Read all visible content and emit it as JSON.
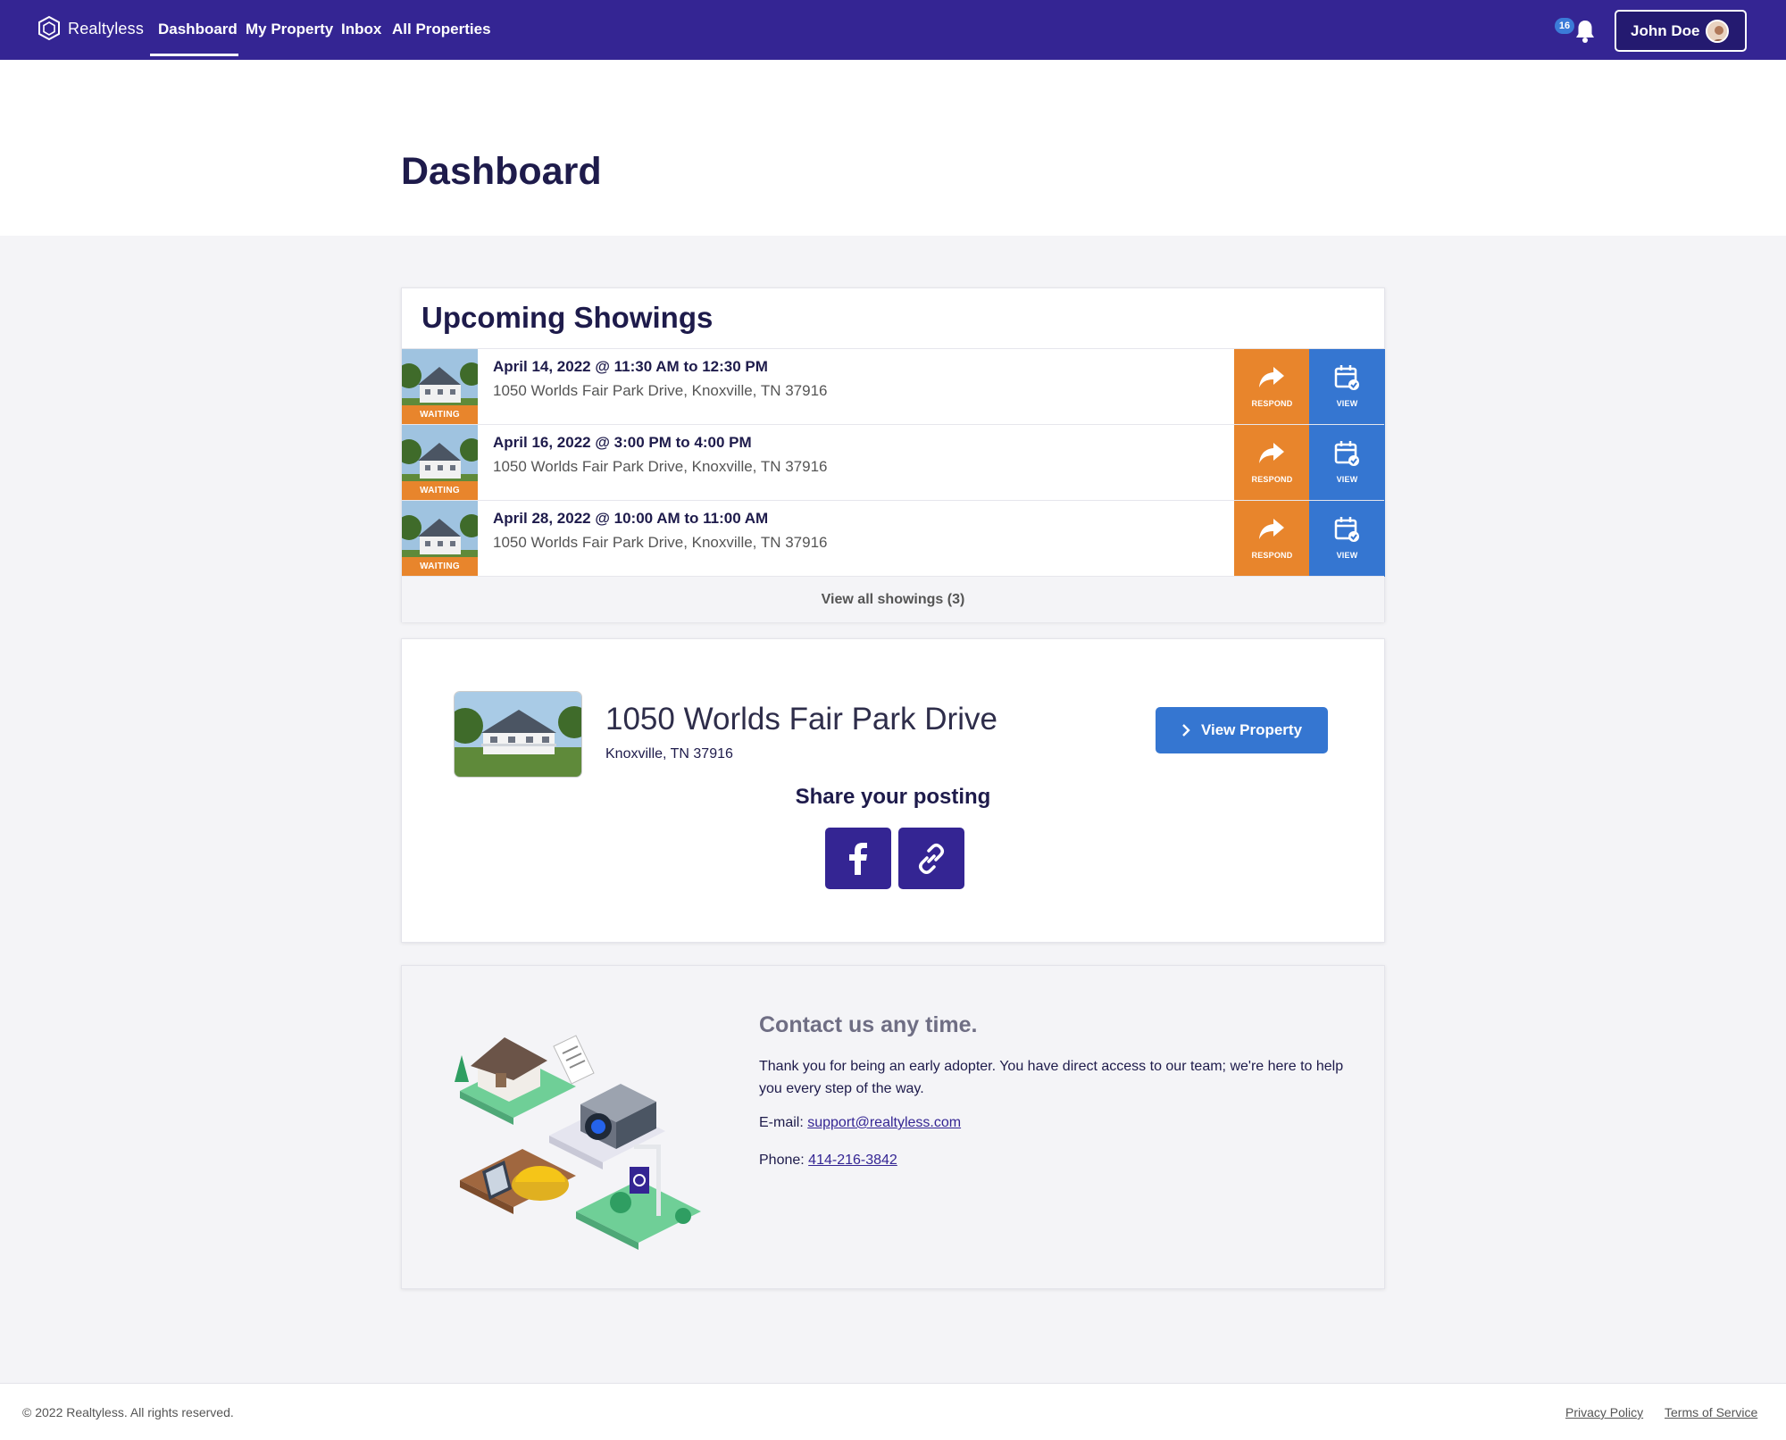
{
  "nav": {
    "brand": "Realtyless",
    "links": [
      "Dashboard",
      "My Property",
      "Inbox",
      "All Properties"
    ],
    "active": "Dashboard",
    "notification_count": "16",
    "user_name": "John Doe"
  },
  "page": {
    "title": "Dashboard"
  },
  "showings": {
    "title": "Upcoming Showings",
    "rows": [
      {
        "date": "April 14, 2022 @ 11:30 AM to 12:30 PM",
        "address": "1050 Worlds Fair Park Drive, Knoxville, TN 37916",
        "status": "WAITING"
      },
      {
        "date": "April 16, 2022 @ 3:00 PM to 4:00 PM",
        "address": "1050 Worlds Fair Park Drive, Knoxville, TN 37916",
        "status": "WAITING"
      },
      {
        "date": "April 28, 2022 @ 10:00 AM to 11:00 AM",
        "address": "1050 Worlds Fair Park Drive, Knoxville, TN 37916",
        "status": "WAITING"
      }
    ],
    "respond_label": "RESPOND",
    "view_label": "VIEW",
    "view_all": "View all showings (3)"
  },
  "property": {
    "title": "1050 Worlds Fair Park Drive",
    "subtitle": "Knoxville, TN 37916",
    "view_button": "View Property",
    "share_title": "Share your posting"
  },
  "contact": {
    "title": "Contact us any time.",
    "text": "Thank you for being an early adopter. You have direct access to our team; we're here to help you every step of the way.",
    "email_label": "E-mail:",
    "email": "support@realtyless.com",
    "phone_label": "Phone:",
    "phone": "414-216-3842"
  },
  "footer": {
    "copyright": "© 2022 Realtyless. All rights reserved.",
    "privacy": "Privacy Policy",
    "terms": "Terms of Service"
  },
  "colors": {
    "nav_bg": "#342593",
    "respond": "#e8852c",
    "view": "#3576d1",
    "title": "#1e1b4b"
  }
}
